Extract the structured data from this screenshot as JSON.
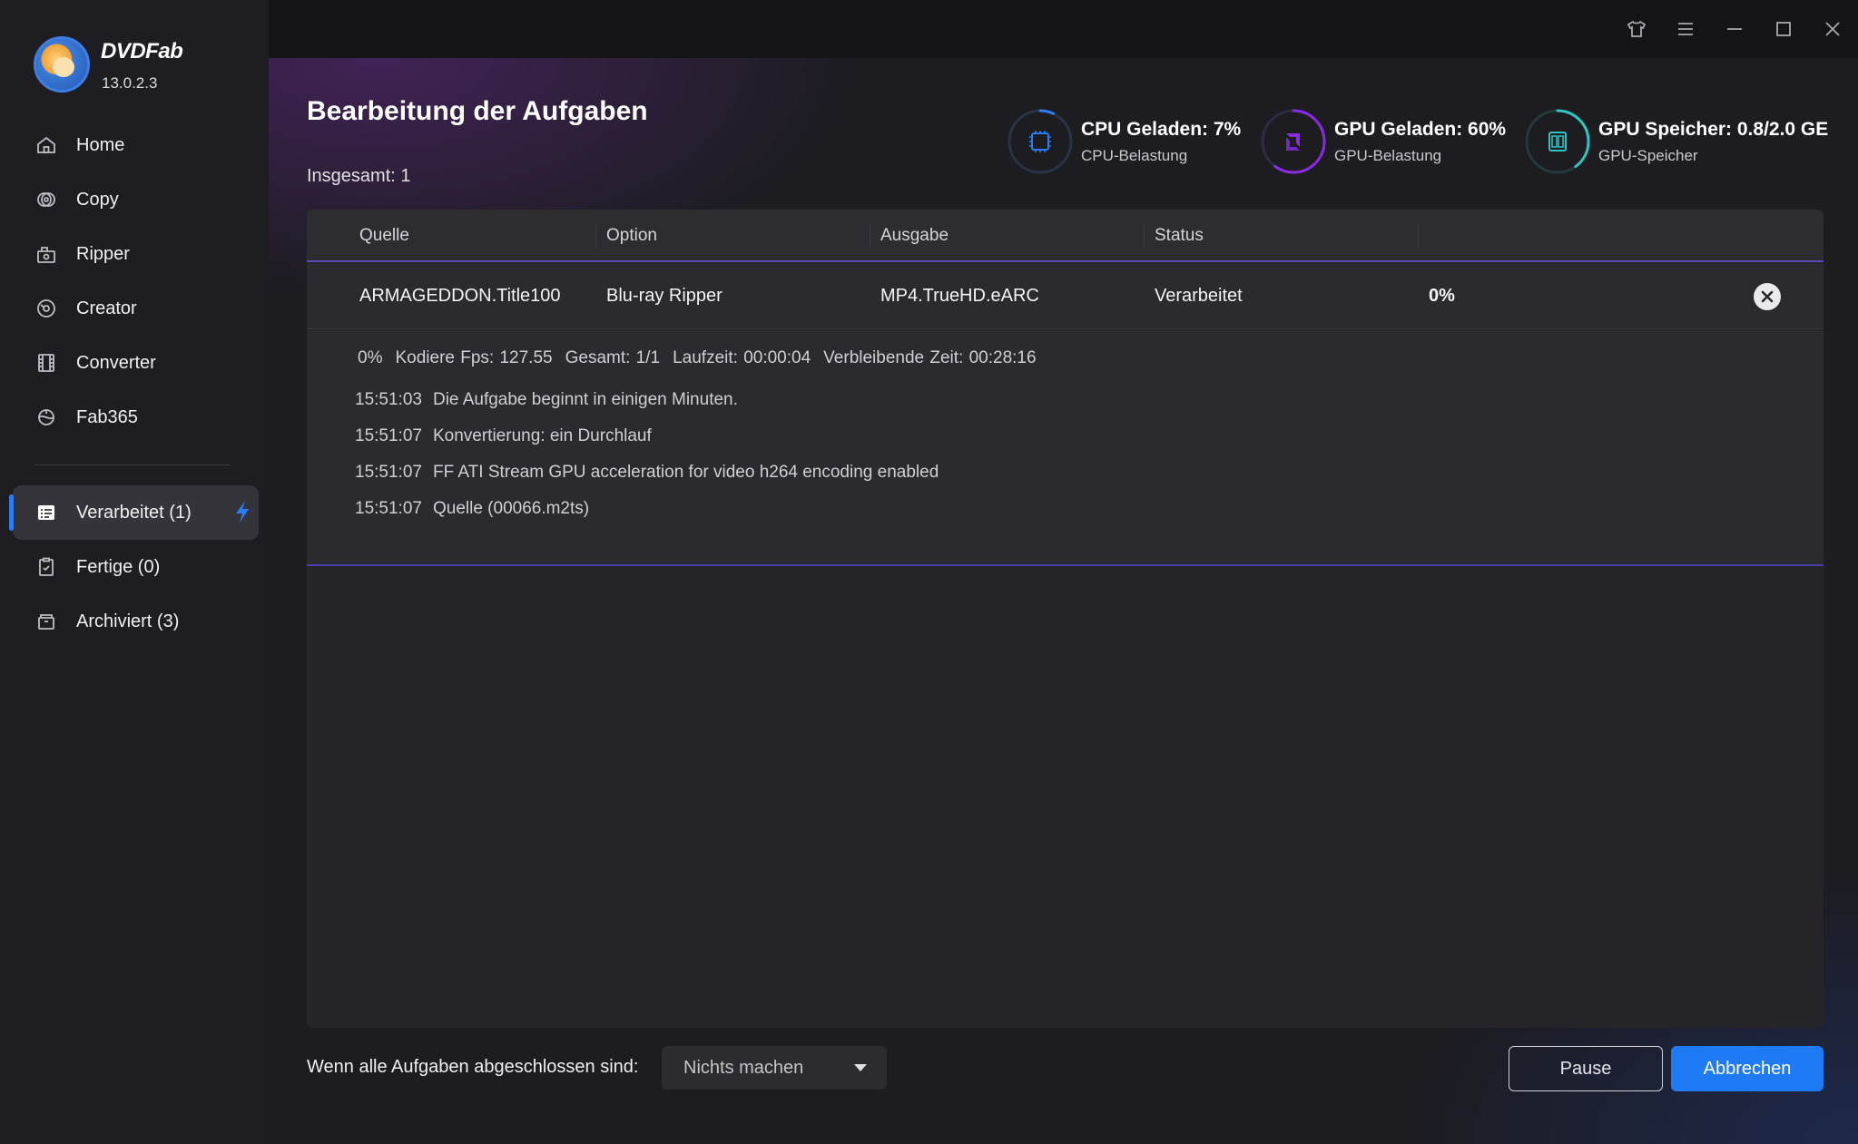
{
  "app": {
    "name": "DVDFab",
    "version": "13.0.2.3"
  },
  "sidebar": {
    "items": [
      {
        "label": "Home",
        "icon": "home-icon"
      },
      {
        "label": "Copy",
        "icon": "copy-icon"
      },
      {
        "label": "Ripper",
        "icon": "ripper-icon"
      },
      {
        "label": "Creator",
        "icon": "creator-icon"
      },
      {
        "label": "Converter",
        "icon": "converter-icon"
      },
      {
        "label": "Fab365",
        "icon": "fab365-icon"
      }
    ],
    "queue": [
      {
        "label": "Verarbeitet (1)",
        "icon": "task-list-icon",
        "active": true
      },
      {
        "label": "Fertige (0)",
        "icon": "clipboard-check-icon",
        "active": false
      },
      {
        "label": "Archiviert (3)",
        "icon": "archive-icon",
        "active": false
      }
    ]
  },
  "window_controls": [
    "shirt-icon",
    "menu-icon",
    "minimize-icon",
    "maximize-icon",
    "close-icon"
  ],
  "page": {
    "title": "Bearbeitung der Aufgaben",
    "total": "Insgesamt: 1"
  },
  "stats": [
    {
      "title": "CPU Geladen: 7%",
      "subtitle": "CPU-Belastung",
      "value": 0.07,
      "color": "#2c7cf6",
      "icon": "cpu-icon"
    },
    {
      "title": "GPU Geladen: 60%",
      "subtitle": "GPU-Belastung",
      "value": 0.6,
      "color": "#8a2be2",
      "icon": "amd-gpu-icon"
    },
    {
      "title": "GPU Speicher: 0.8/2.0 GE",
      "subtitle": "GPU-Speicher",
      "value": 0.4,
      "color": "#2ec4c4",
      "icon": "gpu-memory-icon"
    }
  ],
  "table": {
    "headers": [
      "Quelle",
      "Option",
      "Ausgabe",
      "Status"
    ],
    "rows": [
      {
        "source": "ARMAGEDDON.Title100",
        "option": "Blu-ray Ripper",
        "output": "MP4.TrueHD.eARC",
        "status": "Verarbeitet",
        "progress": "0%"
      }
    ],
    "detail": {
      "progress": [
        "0%",
        "Kodiere Fps: 127.55",
        "Gesamt: 1/1",
        "Laufzeit: 00:00:04",
        "Verbleibende Zeit: 00:28:16"
      ],
      "log": [
        {
          "time": "15:51:03",
          "text": "Die Aufgabe beginnt in einigen Minuten."
        },
        {
          "time": "15:51:07",
          "text": "Konvertierung: ein Durchlauf"
        },
        {
          "time": "15:51:07",
          "text": "FF ATI Stream GPU acceleration for video h264 encoding enabled"
        },
        {
          "time": "15:51:07",
          "text": "Quelle (00066.m2ts)"
        }
      ]
    }
  },
  "footer": {
    "label": "Wenn alle Aufgaben abgeschlossen sind:",
    "select_value": "Nichts machen",
    "pause_label": "Pause",
    "cancel_label": "Abbrechen"
  }
}
